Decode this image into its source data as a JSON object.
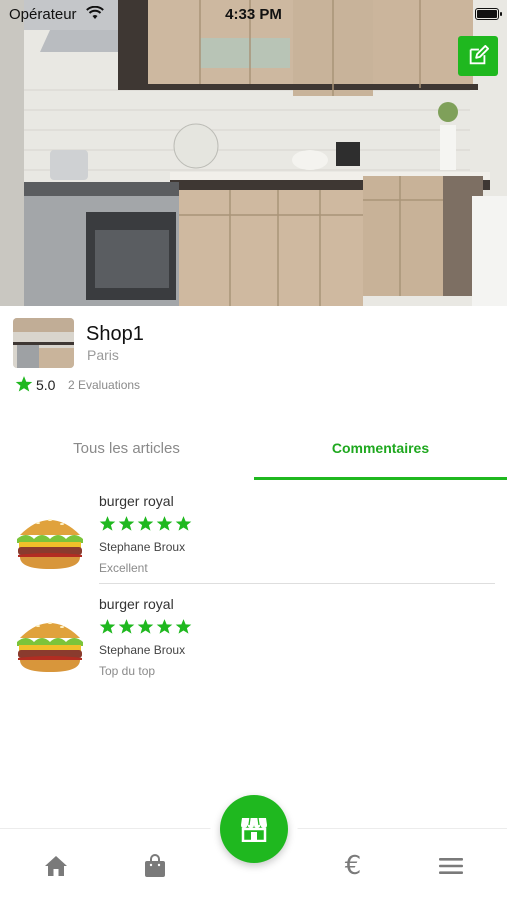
{
  "status_bar": {
    "carrier": "Opérateur",
    "time": "4:33 PM"
  },
  "shop": {
    "name": "Shop1",
    "city": "Paris",
    "rating": "5.0",
    "rating_count": "2 Evaluations"
  },
  "tabs": [
    {
      "label": "Tous les articles",
      "active": false
    },
    {
      "label": "Commentaires",
      "active": true
    }
  ],
  "reviews": [
    {
      "product": "burger royal",
      "stars": 5,
      "author": "Stephane Broux",
      "comment": "Excellent"
    },
    {
      "product": "burger royal",
      "stars": 5,
      "author": "Stephane Broux",
      "comment": "Top du top"
    }
  ],
  "bottom_nav": {
    "items": [
      "home-icon",
      "shopping-bag-icon",
      "store-icon",
      "euro-icon",
      "menu-icon"
    ],
    "euro_symbol": "€"
  },
  "colors": {
    "accent": "#1fb81f",
    "star": "#1fb81f"
  }
}
